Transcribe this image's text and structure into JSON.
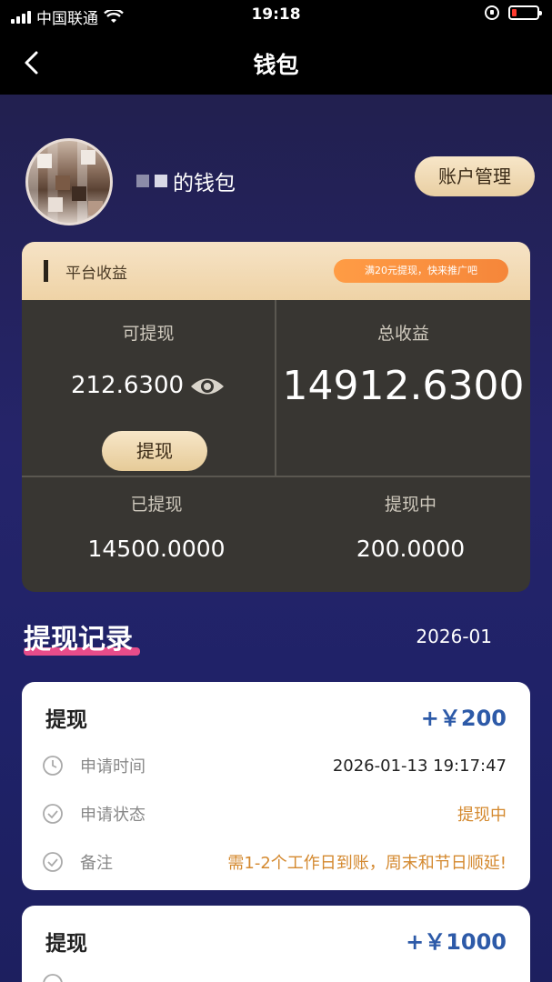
{
  "status_bar": {
    "carrier": "中国联通",
    "time": "19:18"
  },
  "nav": {
    "title": "钱包"
  },
  "profile": {
    "wallet_suffix": "的钱包",
    "account_button": "账户管理"
  },
  "earnings": {
    "header_label": "平台收益",
    "promo": "满20元提现，快来推广吧",
    "withdrawable_label": "可提现",
    "withdrawable_value": "212.6300",
    "total_label": "总收益",
    "total_value": "14912.6300",
    "withdraw_button": "提现",
    "withdrawn_label": "已提现",
    "withdrawn_value": "14500.0000",
    "pending_label": "提现中",
    "pending_value": "200.0000"
  },
  "records": {
    "title": "提现记录",
    "month": "2026-01",
    "items": [
      {
        "type": "提现",
        "amount": "+￥200",
        "time_label": "申请时间",
        "time_value": "2026-01-13 19:17:47",
        "status_label": "申请状态",
        "status_value": "提现中",
        "note_label": "备注",
        "note_value": "需1-2个工作日到账，周末和节日顺延!"
      },
      {
        "type": "提现",
        "amount": "+￥1000"
      }
    ]
  },
  "colors": {
    "accent_gold": "#efd3a6",
    "amount_blue": "#2d5aa8",
    "status_orange": "#d4892f",
    "highlight_pink": "#e74c8a"
  }
}
